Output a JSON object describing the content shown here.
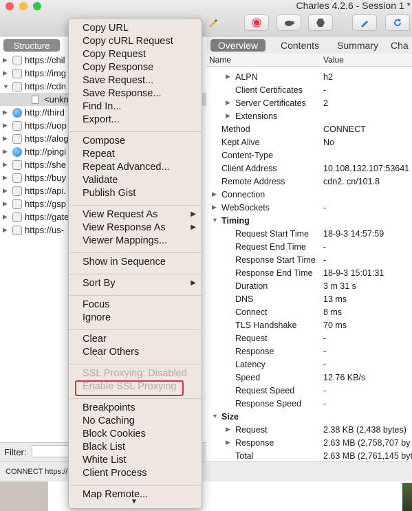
{
  "window": {
    "title": "Charles 4.2.6 - Session 1 *",
    "traffic_lights": {
      "close": "#fc605c",
      "minimize": "#fdbc40",
      "zoom": "#34c84a"
    }
  },
  "toolbar": {
    "icons": [
      "pen-icon",
      "record-icon",
      "throttle-turtle-icon",
      "breakpoint-hexagon-icon",
      "edit-pencil-icon",
      "refresh-icon"
    ]
  },
  "left": {
    "structure_label": "Structure",
    "tree": [
      {
        "label": "https://chil",
        "icon": "lock",
        "arrow": "▶"
      },
      {
        "label": "https://img",
        "icon": "lock",
        "arrow": "▶"
      },
      {
        "label": "https://cdn",
        "icon": "lock",
        "arrow": "▼"
      },
      {
        "label": "<unkno",
        "icon": "doc",
        "arrow": ""
      },
      {
        "label": "http://third",
        "icon": "globe",
        "arrow": "▶"
      },
      {
        "label": "https://uop",
        "icon": "lock",
        "arrow": "▶"
      },
      {
        "label": "https://alog",
        "icon": "lock",
        "arrow": "▶"
      },
      {
        "label": "http://pingi",
        "icon": "globe",
        "arrow": "▶"
      },
      {
        "label": "https://she",
        "icon": "lock",
        "arrow": "▶"
      },
      {
        "label": "https://buy",
        "icon": "lock",
        "arrow": "▶"
      },
      {
        "label": "https://api.",
        "icon": "lock",
        "arrow": "▶"
      },
      {
        "label": "https://gsp",
        "icon": "lock",
        "arrow": "▶"
      },
      {
        "label": "https://gate",
        "icon": "lock",
        "arrow": "▶"
      },
      {
        "label": "https://us-",
        "icon": "lock",
        "arrow": "▶"
      }
    ],
    "filter_label": "Filter:"
  },
  "status": {
    "text": "CONNECT https://"
  },
  "right": {
    "tabs": [
      "Overview",
      "Contents",
      "Summary",
      "Cha"
    ],
    "col_name": "Name",
    "col_value": "Value",
    "rows": [
      {
        "name": "ALPN",
        "value": "h2",
        "indent": 2,
        "tri": "▶",
        "bold": false
      },
      {
        "name": "Client Certificates",
        "value": "-",
        "indent": 2,
        "tri": "",
        "bold": false
      },
      {
        "name": "Server Certificates",
        "value": "2",
        "indent": 2,
        "tri": "▶",
        "bold": false
      },
      {
        "name": "Extensions",
        "value": "",
        "indent": 2,
        "tri": "▶",
        "bold": false
      },
      {
        "name": "Method",
        "value": "CONNECT",
        "indent": 1,
        "tri": "",
        "bold": false
      },
      {
        "name": "Kept Alive",
        "value": "No",
        "indent": 1,
        "tri": "",
        "bold": false
      },
      {
        "name": "Content-Type",
        "value": "",
        "indent": 1,
        "tri": "",
        "bold": false
      },
      {
        "name": "Client Address",
        "value": "10.108.132.107:53641",
        "indent": 1,
        "tri": "",
        "bold": false
      },
      {
        "name": "Remote Address",
        "value": "cdn2.            cn/101.8",
        "indent": 1,
        "tri": "",
        "bold": false
      },
      {
        "name": "Connection",
        "value": "",
        "indent": 0,
        "tri": "▶",
        "bold": false
      },
      {
        "name": "WebSockets",
        "value": "-",
        "indent": 0,
        "tri": "▶",
        "bold": false
      },
      {
        "name": "Timing",
        "value": "",
        "indent": 0,
        "tri": "▼",
        "bold": true
      },
      {
        "name": "Request Start Time",
        "value": "18-9-3 14:57:59",
        "indent": 2,
        "tri": "",
        "bold": false
      },
      {
        "name": "Request End Time",
        "value": "-",
        "indent": 2,
        "tri": "",
        "bold": false
      },
      {
        "name": "Response Start Time",
        "value": "-",
        "indent": 2,
        "tri": "",
        "bold": false
      },
      {
        "name": "Response End Time",
        "value": "18-9-3 15:01:31",
        "indent": 2,
        "tri": "",
        "bold": false
      },
      {
        "name": "Duration",
        "value": "3 m 31 s",
        "indent": 2,
        "tri": "",
        "bold": false
      },
      {
        "name": "DNS",
        "value": "13 ms",
        "indent": 2,
        "tri": "",
        "bold": false
      },
      {
        "name": "Connect",
        "value": "8 ms",
        "indent": 2,
        "tri": "",
        "bold": false
      },
      {
        "name": "TLS Handshake",
        "value": "70 ms",
        "indent": 2,
        "tri": "",
        "bold": false
      },
      {
        "name": "Request",
        "value": "-",
        "indent": 2,
        "tri": "",
        "bold": false
      },
      {
        "name": "Response",
        "value": "-",
        "indent": 2,
        "tri": "",
        "bold": false
      },
      {
        "name": "Latency",
        "value": "-",
        "indent": 2,
        "tri": "",
        "bold": false
      },
      {
        "name": "Speed",
        "value": "12.76 KB/s",
        "indent": 2,
        "tri": "",
        "bold": false
      },
      {
        "name": "Request Speed",
        "value": "-",
        "indent": 2,
        "tri": "",
        "bold": false
      },
      {
        "name": "Response Speed",
        "value": "-",
        "indent": 2,
        "tri": "",
        "bold": false
      },
      {
        "name": "Size",
        "value": "",
        "indent": 0,
        "tri": "▼",
        "bold": true
      },
      {
        "name": "Request",
        "value": "2.38 KB (2,438 bytes)",
        "indent": 2,
        "tri": "▶",
        "bold": false
      },
      {
        "name": "Response",
        "value": "2.63 MB (2,758,707 by",
        "indent": 2,
        "tri": "▶",
        "bold": false
      },
      {
        "name": "Total",
        "value": "2.63 MB (2,761,145 byt",
        "indent": 2,
        "tri": "",
        "bold": false
      }
    ]
  },
  "menu": {
    "items": [
      {
        "label": "Copy URL",
        "enabled": true,
        "submenu": false
      },
      {
        "label": "Copy cURL Request",
        "enabled": true,
        "submenu": false
      },
      {
        "label": "Copy Request",
        "enabled": true,
        "submenu": false
      },
      {
        "label": "Copy Response",
        "enabled": true,
        "submenu": false
      },
      {
        "label": "Save Request...",
        "enabled": true,
        "submenu": false
      },
      {
        "label": "Save Response...",
        "enabled": true,
        "submenu": false
      },
      {
        "label": "Find In...",
        "enabled": true,
        "submenu": false
      },
      {
        "label": "Export...",
        "enabled": true,
        "submenu": false
      },
      {
        "sep": true
      },
      {
        "label": "Compose",
        "enabled": true,
        "submenu": false
      },
      {
        "label": "Repeat",
        "enabled": true,
        "submenu": false
      },
      {
        "label": "Repeat Advanced...",
        "enabled": true,
        "submenu": false
      },
      {
        "label": "Validate",
        "enabled": true,
        "submenu": false
      },
      {
        "label": "Publish Gist",
        "enabled": true,
        "submenu": false
      },
      {
        "sep": true
      },
      {
        "label": "View Request As",
        "enabled": true,
        "submenu": true
      },
      {
        "label": "View Response As",
        "enabled": true,
        "submenu": true
      },
      {
        "label": "Viewer Mappings...",
        "enabled": true,
        "submenu": false
      },
      {
        "sep": true
      },
      {
        "label": "Show in Sequence",
        "enabled": true,
        "submenu": false
      },
      {
        "sep": true
      },
      {
        "label": "Sort By",
        "enabled": true,
        "submenu": true
      },
      {
        "sep": true
      },
      {
        "label": "Focus",
        "enabled": true,
        "submenu": false
      },
      {
        "label": "Ignore",
        "enabled": true,
        "submenu": false
      },
      {
        "sep": true
      },
      {
        "label": "Clear",
        "enabled": true,
        "submenu": false
      },
      {
        "label": "Clear Others",
        "enabled": true,
        "submenu": false
      },
      {
        "sep": true
      },
      {
        "label": "SSL Proxying: Disabled",
        "enabled": false,
        "submenu": false
      },
      {
        "label": "Enable SSL Proxying",
        "enabled": false,
        "submenu": false
      },
      {
        "sep": true
      },
      {
        "label": "Breakpoints",
        "enabled": true,
        "submenu": false
      },
      {
        "label": "No Caching",
        "enabled": true,
        "submenu": false
      },
      {
        "label": "Block Cookies",
        "enabled": true,
        "submenu": false
      },
      {
        "label": "Black List",
        "enabled": true,
        "submenu": false
      },
      {
        "label": "White List",
        "enabled": true,
        "submenu": false
      },
      {
        "label": "Client Process",
        "enabled": true,
        "submenu": false
      },
      {
        "sep": true
      },
      {
        "label": "Map Remote...",
        "enabled": true,
        "submenu": false
      }
    ],
    "highlight_color": "#d6353a"
  }
}
